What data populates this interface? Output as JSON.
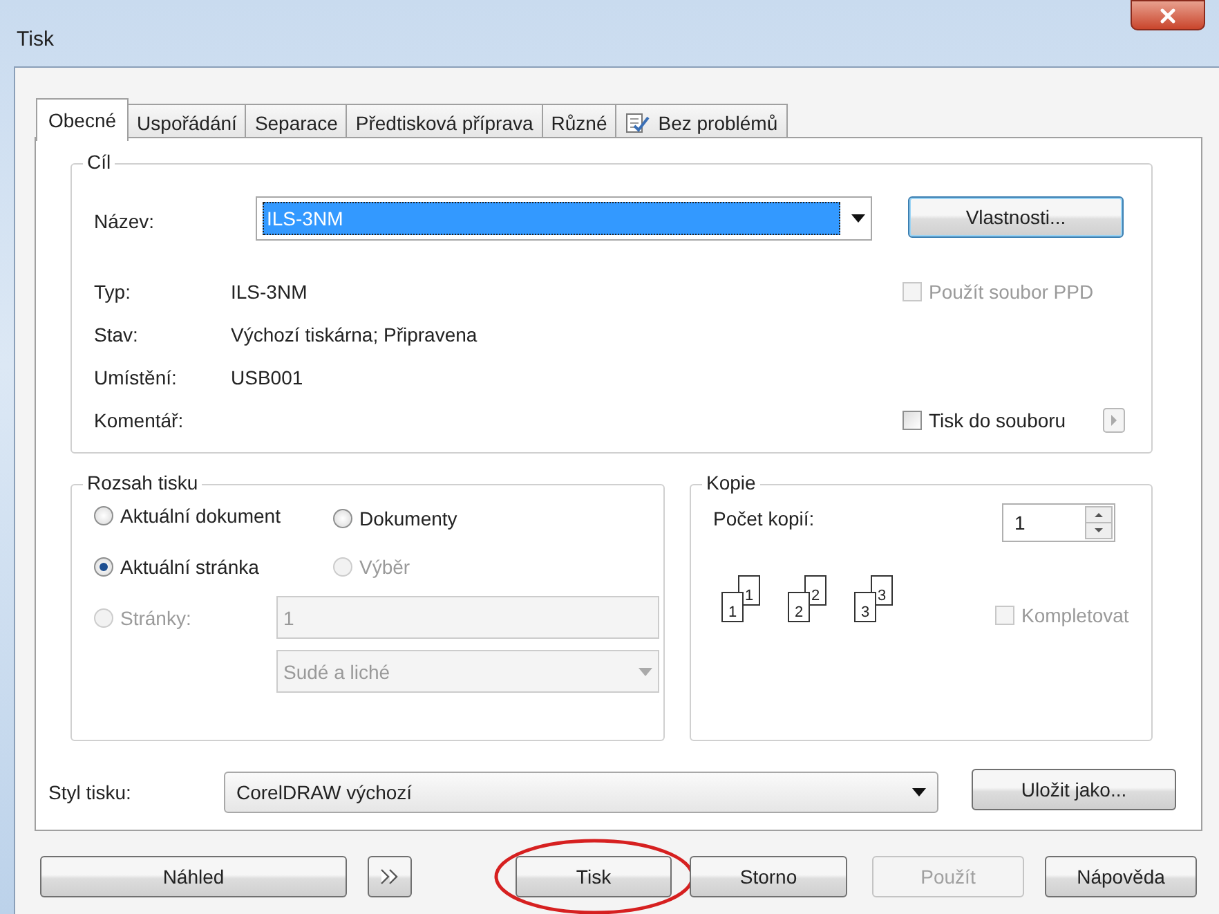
{
  "window": {
    "title": "Tisk"
  },
  "tabs": [
    {
      "label": "Obecné",
      "selected": true,
      "kind": "plain"
    },
    {
      "label": "Uspořádání",
      "selected": false,
      "kind": "plain"
    },
    {
      "label": "Separace",
      "selected": false,
      "kind": "plain"
    },
    {
      "label": "Předtisková příprava",
      "selected": false,
      "kind": "plain"
    },
    {
      "label": "Různé",
      "selected": false,
      "kind": "plain"
    },
    {
      "label": "Bez problémů",
      "selected": false,
      "kind": "checklist"
    }
  ],
  "destination": {
    "title": "Cíl",
    "name_label": "Název:",
    "name_value": "ILS-3NM",
    "properties_button": "Vlastnosti...",
    "info": [
      {
        "label": "Typ:",
        "value": "ILS-3NM"
      },
      {
        "label": "Stav:",
        "value": "Výchozí tiskárna; Připravena"
      },
      {
        "label": "Umístění:",
        "value": "USB001"
      },
      {
        "label": "Komentář:"
      }
    ],
    "use_ppd": {
      "label": "Použít soubor PPD",
      "checked": false,
      "disabled": true
    },
    "print_to_file": {
      "label": "Tisk do souboru",
      "checked": false,
      "disabled": false
    }
  },
  "range": {
    "title": "Rozsah tisku",
    "options": [
      {
        "label": "Aktuální dokument",
        "selected": false,
        "disabled": false
      },
      {
        "label": "Dokumenty",
        "selected": false,
        "disabled": false
      },
      {
        "label": "Aktuální stránka",
        "selected": true,
        "disabled": false
      },
      {
        "label": "Výběr",
        "selected": false,
        "disabled": true
      },
      {
        "label": "Stránky:",
        "selected": false,
        "disabled": true
      }
    ],
    "pages_value": "1",
    "subset": "Sudé a liché"
  },
  "copies": {
    "title": "Kopie",
    "count_label": "Počet kopií:",
    "count_value": "1",
    "collate_preview": [
      {
        "back": "1",
        "front": "1"
      },
      {
        "back": "2",
        "front": "2"
      },
      {
        "back": "3",
        "front": "3"
      }
    ],
    "collate": {
      "label": "Kompletovat",
      "checked": false,
      "disabled": true
    }
  },
  "style": {
    "label": "Styl tisku:",
    "value": "CorelDRAW výchozí",
    "save_button": "Uložit jako..."
  },
  "buttons": [
    {
      "kind": "text",
      "label": "Náhled",
      "disabled": false
    },
    {
      "kind": "expand",
      "disabled": false
    },
    {
      "kind": "text",
      "label": "Tisk",
      "disabled": false,
      "circled": true
    },
    {
      "kind": "text",
      "label": "Storno",
      "disabled": false
    },
    {
      "kind": "text",
      "label": "Použít",
      "disabled": true
    },
    {
      "kind": "text",
      "label": "Nápověda",
      "disabled": false
    }
  ]
}
